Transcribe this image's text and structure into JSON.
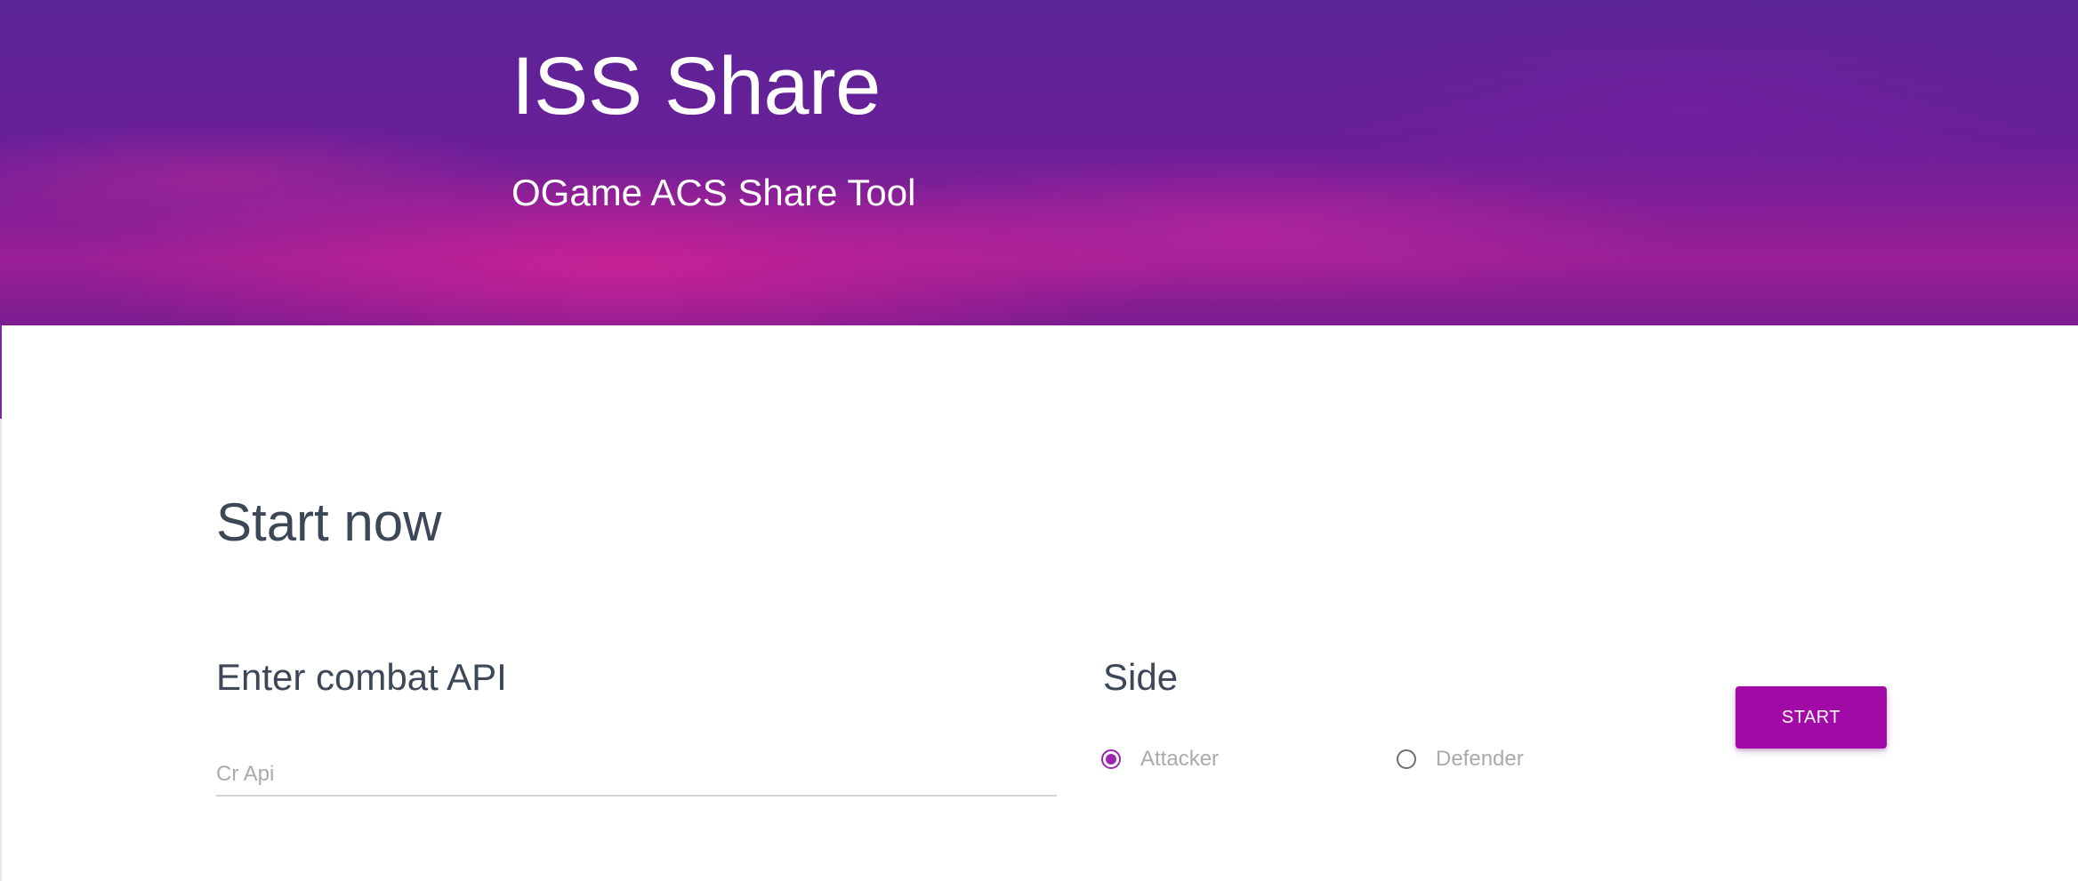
{
  "hero": {
    "title": "ISS Share",
    "subtitle": "OGame ACS Share Tool"
  },
  "main": {
    "section_title": "Start now",
    "combat_api": {
      "label": "Enter combat API",
      "placeholder": "Cr Api",
      "value": ""
    },
    "side": {
      "label": "Side",
      "options": [
        {
          "label": "Attacker",
          "checked": true
        },
        {
          "label": "Defender",
          "checked": false
        }
      ]
    },
    "start_button_label": "START"
  },
  "colors": {
    "accent": "#9c27b0",
    "button": "#a10aa6",
    "heading_text": "#3c4858",
    "muted_text": "#aaaaaa"
  }
}
